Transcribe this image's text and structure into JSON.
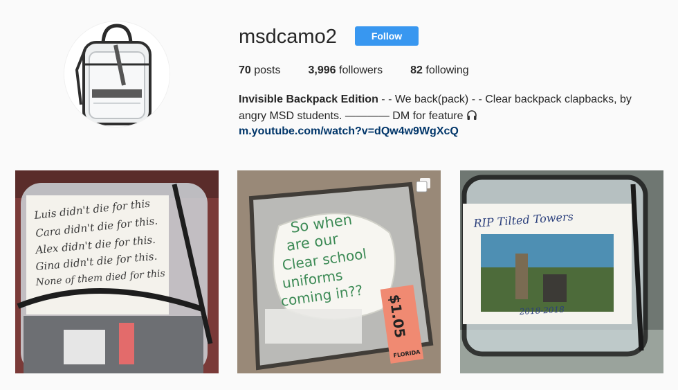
{
  "profile": {
    "username": "msdcamo2",
    "follow_label": "Follow",
    "stats": {
      "posts_count": "70",
      "posts_label": "posts",
      "followers_count": "3,996",
      "followers_label": "followers",
      "following_count": "82",
      "following_label": "following"
    },
    "bio": {
      "name": "Invisible Backpack Edition",
      "text": "- - We back(pack) - - Clear backpack clapbacks, by angry MSD students. ———— DM for feature",
      "link": "m.youtube.com/watch?v=dQw4w9WgXcQ"
    },
    "avatar_icon": "clear-backpack-icon"
  },
  "posts": [
    {
      "note_lines": [
        "Luis didn't die for this",
        "Cara didn't die for this.",
        "Alex didn't die for this.",
        "Gina didn't die for this.",
        "None of them died for this"
      ]
    },
    {
      "note_lines": [
        "So when",
        "are our",
        "Clear school",
        "uniforms",
        "coming in??"
      ],
      "price_tag": "$1.05",
      "tag_brand": "FLORIDA",
      "multi_icon": "multiple-photos-icon"
    },
    {
      "sign_title": "RIP  Tilted Towers",
      "sign_years": "2018-2018"
    }
  ],
  "colors": {
    "follow_button": "#3897f0",
    "link": "#003569",
    "background": "#fafafa"
  }
}
